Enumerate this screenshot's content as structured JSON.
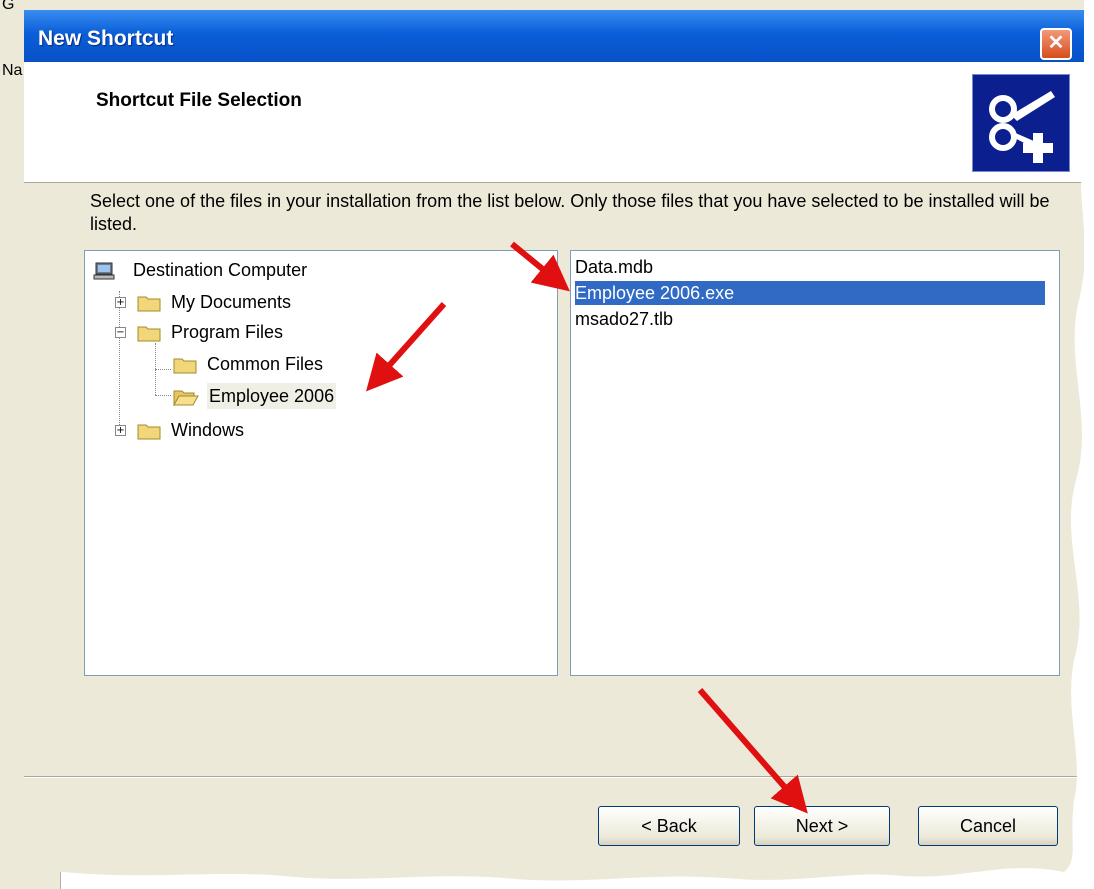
{
  "background": {
    "text_top": "G",
    "text_mid": "Na"
  },
  "dialog": {
    "title": "New Shortcut",
    "close_glyph": "✕",
    "header_title": "Shortcut File Selection",
    "instructions": "Select one of the files in your installation from the list below. Only those files that you have selected to be installed will be listed."
  },
  "tree": {
    "root": "Destination Computer",
    "items": [
      {
        "label": "My Documents",
        "expander": "+"
      },
      {
        "label": "Program Files",
        "expander": "−"
      },
      {
        "label": "Common Files"
      },
      {
        "label": "Employee 2006",
        "selected": true
      },
      {
        "label": "Windows",
        "expander": "+"
      }
    ]
  },
  "files": [
    {
      "label": "Data.mdb"
    },
    {
      "label": "Employee 2006.exe",
      "selected": true
    },
    {
      "label": "msado27.tlb"
    }
  ],
  "buttons": {
    "back": "< Back",
    "next": "Next >",
    "cancel": "Cancel"
  },
  "colors": {
    "titlebar": "#0a5fd8",
    "selection": "#316ac5",
    "annotation_arrow": "#e01010"
  },
  "icons": {
    "computer": "computer-icon",
    "folder": "folder-icon",
    "open_folder": "open-folder-icon",
    "header": "scissors-plus-icon"
  }
}
